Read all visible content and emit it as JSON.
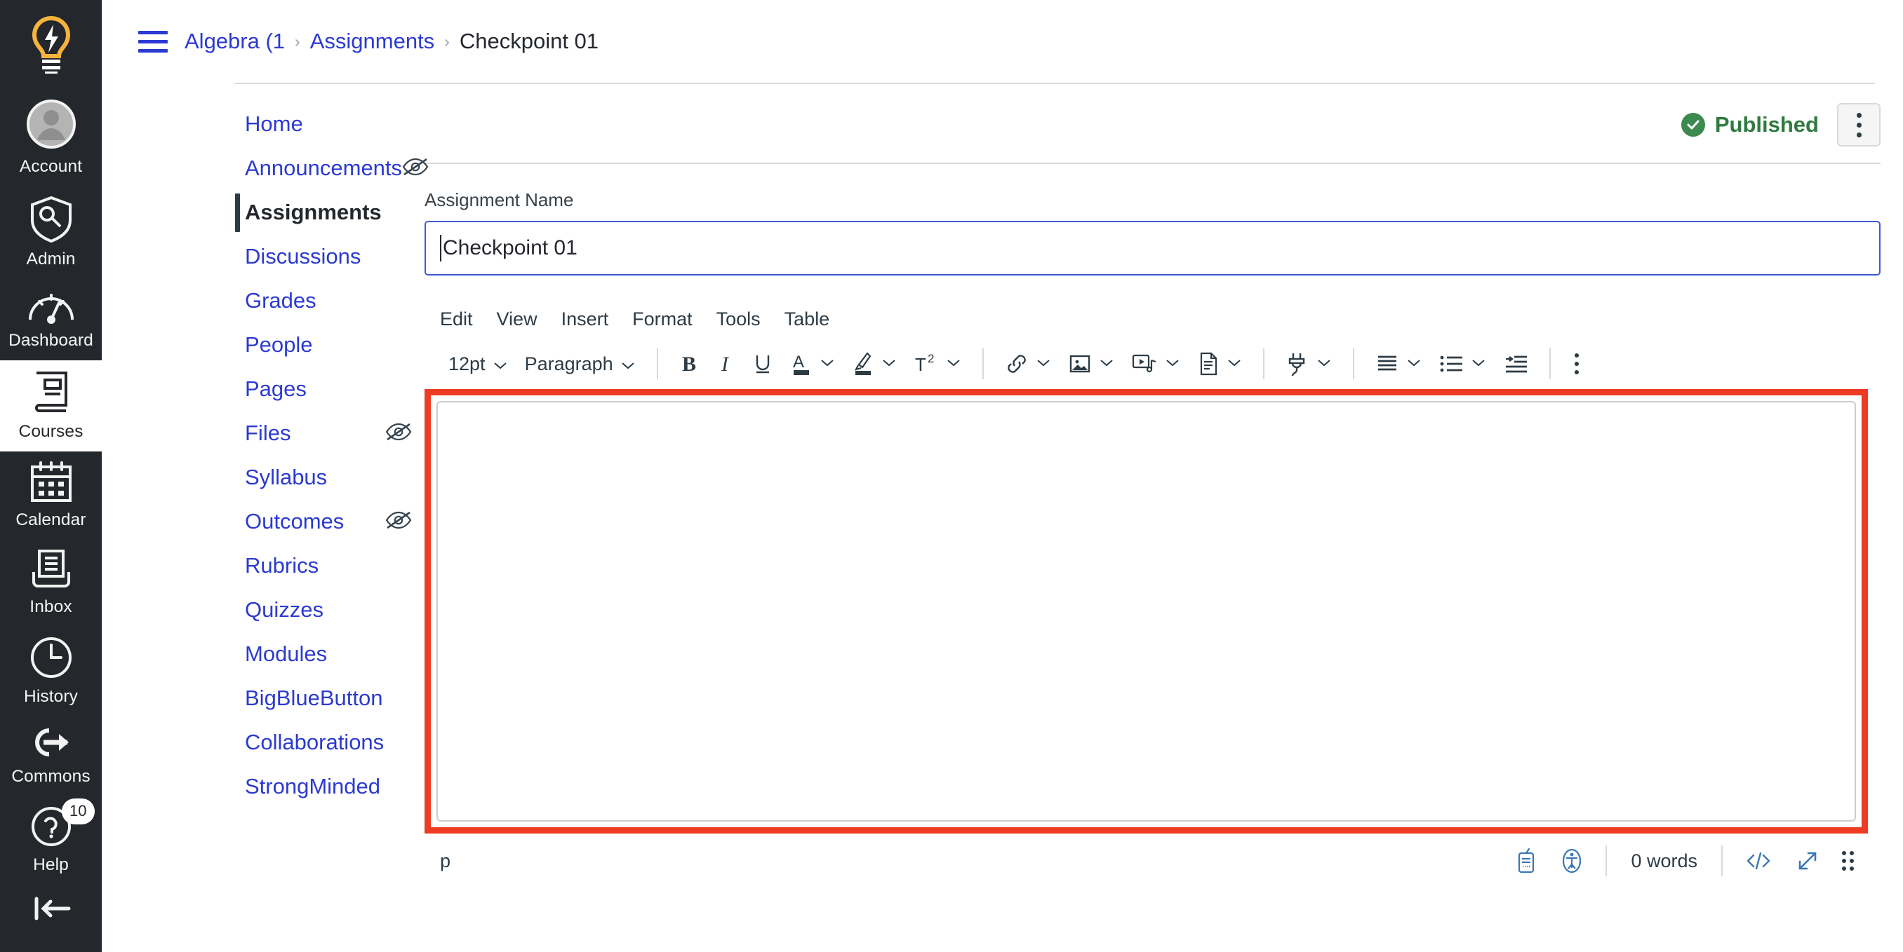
{
  "global_nav": {
    "logo_icon": "lightbulb-logo-icon",
    "items": [
      {
        "label": "Account",
        "icon": "user-avatar-icon",
        "active": false,
        "badge": null
      },
      {
        "label": "Admin",
        "icon": "shield-key-icon",
        "active": false,
        "badge": null
      },
      {
        "label": "Dashboard",
        "icon": "gauge-icon",
        "active": false,
        "badge": null
      },
      {
        "label": "Courses",
        "icon": "book-icon",
        "active": true,
        "badge": null
      },
      {
        "label": "Calendar",
        "icon": "calendar-icon",
        "active": false,
        "badge": null
      },
      {
        "label": "Inbox",
        "icon": "inbox-tray-icon",
        "active": false,
        "badge": null
      },
      {
        "label": "History",
        "icon": "clock-icon",
        "active": false,
        "badge": null
      },
      {
        "label": "Commons",
        "icon": "arrow-export-icon",
        "active": false,
        "badge": null
      },
      {
        "label": "Help",
        "icon": "question-circle-icon",
        "active": false,
        "badge": "10"
      }
    ],
    "collapse_icon": "collapse-left-icon"
  },
  "breadcrumb": {
    "menu_icon": "hamburger-menu-icon",
    "items": [
      {
        "label": "Algebra (1",
        "current": false
      },
      {
        "label": "Assignments",
        "current": false
      },
      {
        "label": "Checkpoint 01",
        "current": true
      }
    ],
    "separator": "›"
  },
  "course_nav": {
    "items": [
      {
        "label": "Home",
        "active": false,
        "hidden_icon": false
      },
      {
        "label": "Announcements",
        "active": false,
        "hidden_icon": true
      },
      {
        "label": "Assignments",
        "active": true,
        "hidden_icon": false
      },
      {
        "label": "Discussions",
        "active": false,
        "hidden_icon": false
      },
      {
        "label": "Grades",
        "active": false,
        "hidden_icon": false
      },
      {
        "label": "People",
        "active": false,
        "hidden_icon": false
      },
      {
        "label": "Pages",
        "active": false,
        "hidden_icon": false
      },
      {
        "label": "Files",
        "active": false,
        "hidden_icon": true
      },
      {
        "label": "Syllabus",
        "active": false,
        "hidden_icon": false
      },
      {
        "label": "Outcomes",
        "active": false,
        "hidden_icon": true
      },
      {
        "label": "Rubrics",
        "active": false,
        "hidden_icon": false
      },
      {
        "label": "Quizzes",
        "active": false,
        "hidden_icon": false
      },
      {
        "label": "Modules",
        "active": false,
        "hidden_icon": false
      },
      {
        "label": "BigBlueButton",
        "active": false,
        "hidden_icon": false
      },
      {
        "label": "Collaborations",
        "active": false,
        "hidden_icon": false
      },
      {
        "label": "StrongMinded",
        "active": false,
        "hidden_icon": false
      }
    ],
    "hidden_icon_name": "eye-slash-icon"
  },
  "header": {
    "publish_status": "Published",
    "publish_icon": "check-circle-icon",
    "kebab_icon": "more-options-kebab-icon"
  },
  "assignment": {
    "name_label": "Assignment Name",
    "name_value": "Checkpoint 01",
    "name_placeholder": ""
  },
  "editor": {
    "menubar": [
      "Edit",
      "View",
      "Insert",
      "Format",
      "Tools",
      "Table"
    ],
    "toolbar": {
      "font_size": "12pt",
      "block_format": "Paragraph",
      "buttons": [
        {
          "name": "bold-icon",
          "glyph": "B"
        },
        {
          "name": "italic-icon",
          "glyph": "I"
        },
        {
          "name": "underline-icon",
          "glyph": "U"
        },
        {
          "name": "text-color-icon",
          "glyph": "A"
        },
        {
          "name": "highlight-color-icon",
          "glyph": "✎"
        },
        {
          "name": "superscript-subscript-icon",
          "glyph": "T²"
        },
        {
          "name": "link-icon",
          "glyph": "⚓"
        },
        {
          "name": "image-icon",
          "glyph": "▣"
        },
        {
          "name": "media-icon",
          "glyph": "▶"
        },
        {
          "name": "document-icon",
          "glyph": "☰"
        },
        {
          "name": "apps-plug-icon",
          "glyph": "⎇"
        },
        {
          "name": "align-icon",
          "glyph": "≡"
        },
        {
          "name": "list-icon",
          "glyph": "•≡"
        },
        {
          "name": "indent-icon",
          "glyph": "⇥"
        }
      ],
      "overflow_icon": "toolbar-more-kebab-icon"
    },
    "body_content": "",
    "status_bar": {
      "element_path": "p",
      "word_count": "0 words",
      "keyboard_icon": "keyboard-shortcuts-icon",
      "a11y_icon": "accessibility-checker-icon",
      "html_editor_icon": "html-editor-icon",
      "fullscreen_icon": "fullscreen-expand-icon",
      "resize_icon": "resize-grip-icon"
    }
  },
  "colors": {
    "nav_bg": "#24272b",
    "link_blue": "#2b3ad1",
    "published_green": "#3d8a4e",
    "highlight_red": "#ee3b24",
    "focus_blue": "#3b5bd4",
    "border_grey": "#d7dade",
    "text_dark": "#24282d"
  }
}
